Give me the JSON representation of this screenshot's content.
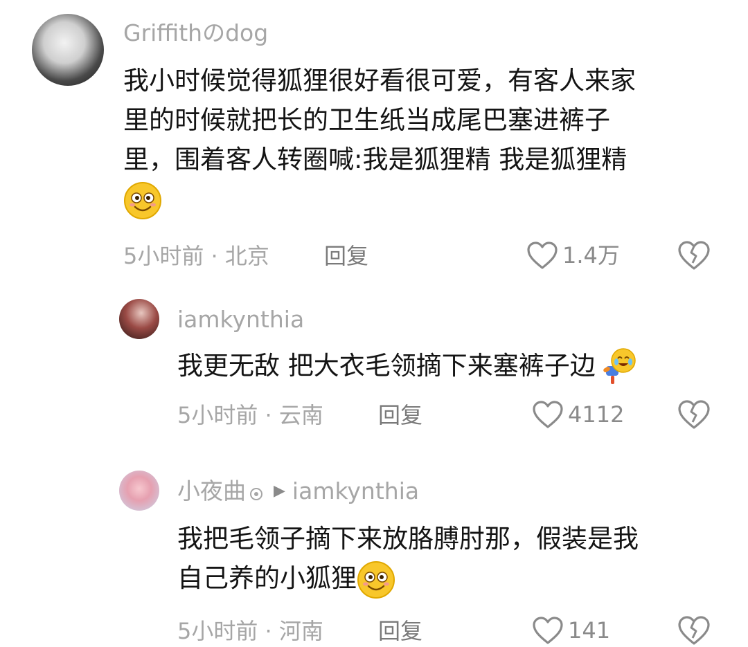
{
  "comments": [
    {
      "user": "Griffithのdog",
      "lines": [
        "我小时候觉得狐狸很好看很可爱，有客人来家",
        "里的时候就把长的卫生纸当成尾巴塞进裤子",
        "里，围着客人转圈喊:我是狐狸精 我是狐狸精"
      ],
      "emoji": "smile-emoji",
      "time_location": "5小时前 · 北京",
      "reply_label": "回复",
      "likes": "1.4万"
    },
    {
      "user": "iamkynthia",
      "text": "我更无敌 把大衣毛领摘下来塞裤子边",
      "emoji": "laugh-cry-emoji",
      "time_location": "5小时前 · 云南",
      "reply_label": "回复",
      "likes": "4112"
    },
    {
      "user": "小夜曲",
      "reply_to": "iamkynthia",
      "lines": [
        "我把毛领子摘下来放胳膊肘那，假装是我",
        "自己养的小狐狸"
      ],
      "emoji": "smile-emoji",
      "time_location": "5小时前 · 河南",
      "reply_label": "回复",
      "likes": "141"
    }
  ],
  "colors": {
    "secondary_text": "#a6a6a6",
    "primary_text": "#141414",
    "emoji_yellow": "#f8c72b"
  }
}
